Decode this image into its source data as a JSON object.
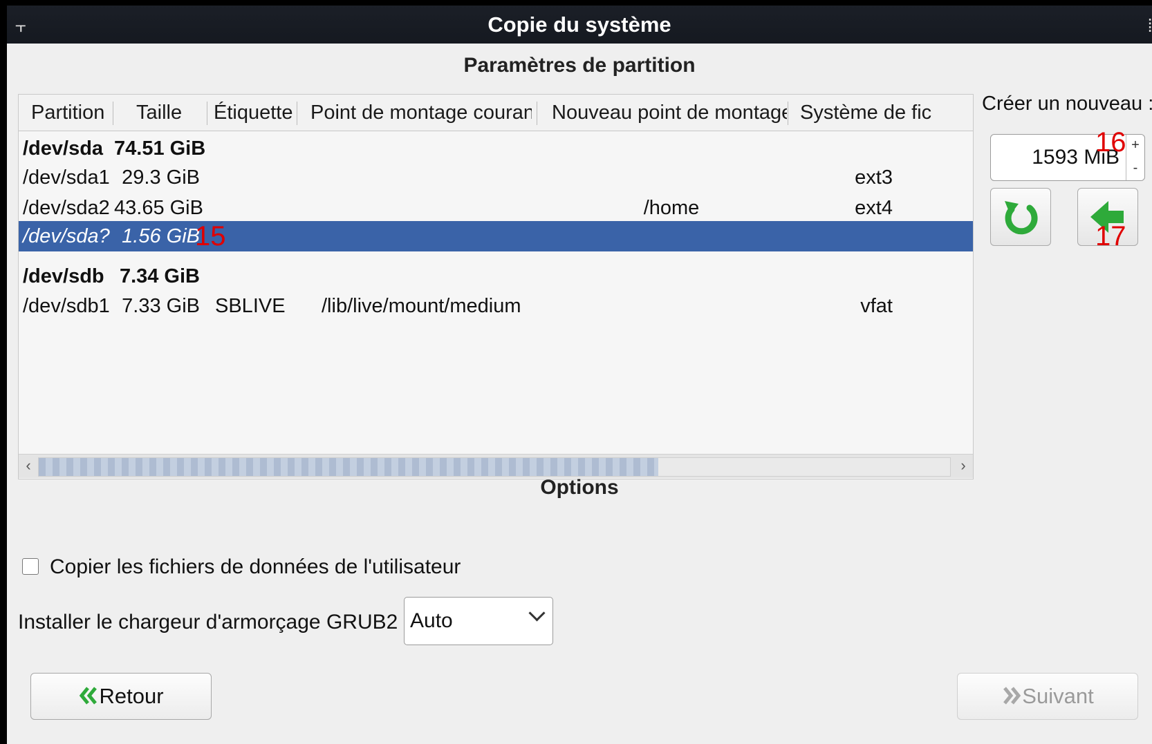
{
  "window": {
    "title": "Copie du système",
    "pin_icon": "pin-icon",
    "grip_icon": "grip-icon"
  },
  "partitions": {
    "section_title": "Paramètres de partition",
    "columns": [
      "Partition",
      "Taille",
      "Étiquette",
      "Point de montage courant",
      "Nouveau point de montage",
      "Système de fic"
    ],
    "rows": [
      {
        "type": "disk",
        "partition": "/dev/sda",
        "size": "74.51 GiB",
        "label": "",
        "current_mount": "",
        "new_mount": "",
        "fs": ""
      },
      {
        "type": "part",
        "partition": "/dev/sda1",
        "size": "29.3 GiB",
        "label": "",
        "current_mount": "",
        "new_mount": "",
        "fs": "ext3"
      },
      {
        "type": "part",
        "partition": "/dev/sda2",
        "size": "43.65 GiB",
        "label": "",
        "current_mount": "",
        "new_mount": "/home",
        "fs": "ext4"
      },
      {
        "type": "selected",
        "partition": "/dev/sda?",
        "size": "1.56 GiB",
        "label": "",
        "current_mount": "",
        "new_mount": "",
        "fs": ""
      },
      {
        "type": "disk",
        "partition": "/dev/sdb",
        "size": "7.34 GiB",
        "label": "",
        "current_mount": "",
        "new_mount": "",
        "fs": ""
      },
      {
        "type": "part",
        "partition": "/dev/sdb1",
        "size": "7.33 GiB",
        "label": "SBLIVE",
        "current_mount": "/lib/live/mount/medium",
        "new_mount": "",
        "fs": "vfat"
      }
    ],
    "scrollbar": {
      "left_arrow": "‹",
      "right_arrow": "›",
      "thumb_fraction": 0.68
    }
  },
  "create": {
    "label": "Créer un nouveau :",
    "size_value": "1593 MiB",
    "spin_up": "+",
    "spin_down": "-",
    "reset_icon": "reset-icon",
    "apply_icon": "arrow-left-icon"
  },
  "annotations": {
    "a15": "15",
    "a16": "16",
    "a17": "17"
  },
  "options": {
    "section_title": "Options",
    "copy_user_data_label": "Copier les fichiers de données de l'utilisateur",
    "copy_user_data_checked": false,
    "grub_label": "Installer le chargeur d'armorçage GRUB2 :",
    "grub_value": "Auto"
  },
  "nav": {
    "back_label": "Retour",
    "next_label": "Suivant",
    "back_icon": "double-chevron-left-icon",
    "next_icon": "double-chevron-right-icon"
  },
  "colors": {
    "selection": "#3a63a8",
    "accent_green": "#2eaa3a",
    "badge_red": "#e00000"
  }
}
